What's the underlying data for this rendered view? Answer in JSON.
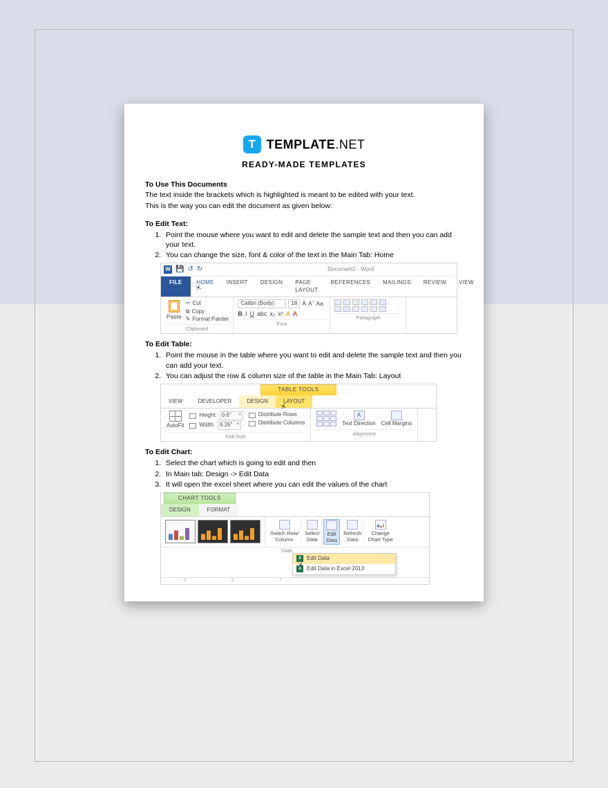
{
  "brand": {
    "badge": "T",
    "name": "TEMPLATE",
    "suffix": ".NET"
  },
  "subtitle": "READY-MADE TEMPLATES",
  "intro": {
    "heading": "To Use This Documents",
    "line1": "The text inside the brackets which is highlighted is meant to be edited with your text.",
    "line2": "This is the way you can edit the document as given below:"
  },
  "edit_text": {
    "heading": "To Edit Text:",
    "items": [
      "Point the mouse where you want to edit and delete the sample text and then you can add your text.",
      "You can change the size, font & color of the text in the Main Tab: Home"
    ]
  },
  "ss1": {
    "word_badge": "W",
    "doc_title": "Document1 - Word",
    "tabs": {
      "file": "FILE",
      "home": "HOME",
      "insert": "INSERT",
      "design": "DESIGN",
      "page_layout": "PAGE LAYOUT",
      "references": "REFERENCES",
      "mailings": "MAILINGS",
      "review": "REVIEW",
      "view": "VIEW"
    },
    "clipboard": {
      "paste": "Paste",
      "cut": "Cut",
      "copy": "Copy",
      "format_painter": "Format Painter",
      "label": "Clipboard"
    },
    "font": {
      "name": "Calibri (Body)",
      "size": "18",
      "label": "Font"
    },
    "paragraph_label": "Paragraph"
  },
  "edit_table": {
    "heading": "To Edit Table:",
    "items": [
      "Point the mouse in the table where you want to edit and delete the sample text and then you can add your text.",
      "You can adjust the row & column size of the table in the Main Tab: Layout"
    ]
  },
  "ss2": {
    "badge": "TABLE TOOLS",
    "tabs": {
      "view": "VIEW",
      "developer": "DEVELOPER",
      "design": "DESIGN",
      "layout": "LAYOUT"
    },
    "autofit": "AutoFit",
    "height_label": "Height:",
    "height_val": "0.6\"",
    "width_label": "Width:",
    "width_val": "6.26\"",
    "dist_rows": "Distribute Rows",
    "dist_cols": "Distribute Columns",
    "cell_size": "Cell Size",
    "text_direction": "Text Direction",
    "cell_margins": "Cell Margins",
    "alignment": "Alignment"
  },
  "edit_chart": {
    "heading": "To Edit Chart:",
    "items": [
      "Select the chart which is going to edit and then",
      "In Main tab: Design -> Edit Data",
      "It will open the excel sheet where you can edit the values of the chart"
    ]
  },
  "ss3": {
    "badge": "CHART TOOLS",
    "tabs": {
      "design": "DESIGN",
      "format": "FORMAT"
    },
    "switch": "Switch Row/\nColumn",
    "select": "Select\nData",
    "edit": "Edit\nData",
    "refresh": "Refresh\nData",
    "change": "Change\nChart Type",
    "data_label": "Data",
    "dd1": "Edit Data",
    "dd2": "Edit Data in Excel 2013",
    "xls": "X",
    "ruler": "· · · 5 · · · · · · 6 · · · · · · 7 · · ·"
  }
}
